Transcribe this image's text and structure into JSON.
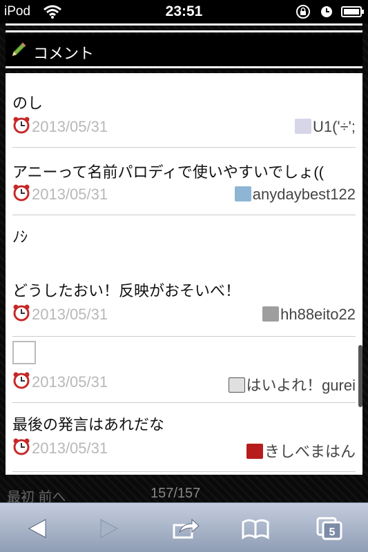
{
  "status_bar": {
    "carrier": "iPod",
    "time": "23:51"
  },
  "section": {
    "title": "コメント"
  },
  "comments": [
    {
      "text": "のし",
      "text2": "",
      "date": "2013/05/31",
      "user": "U1('÷';",
      "has_box": false
    },
    {
      "text": "アニーって名前パロディで使いやすいでしょ((",
      "text2": "",
      "date": "2013/05/31",
      "user": "anydaybest122",
      "has_box": false
    },
    {
      "text": "ﾉｼ",
      "text2": "どうしたおい！反映がおそいべ！",
      "date": "2013/05/31",
      "user": "hh88eito22",
      "has_box": false
    },
    {
      "text": "",
      "text2": "",
      "date": "2013/05/31",
      "user": "はいよれ！gurei",
      "has_box": true
    },
    {
      "text": "最後の発言はあれだな",
      "text2": "",
      "date": "2013/05/31",
      "user": "きしべまはん",
      "has_box": false
    }
  ],
  "pager": {
    "nav": "最初 前へ",
    "count": "157/157"
  },
  "toolbar": {
    "tabs_count": "5"
  },
  "colors": {
    "toolbar_gradient_top": "#c4cddd",
    "toolbar_gradient_bottom": "#8f9db5",
    "date_text": "#b8b8b8",
    "alarm_red": "#c62828"
  }
}
